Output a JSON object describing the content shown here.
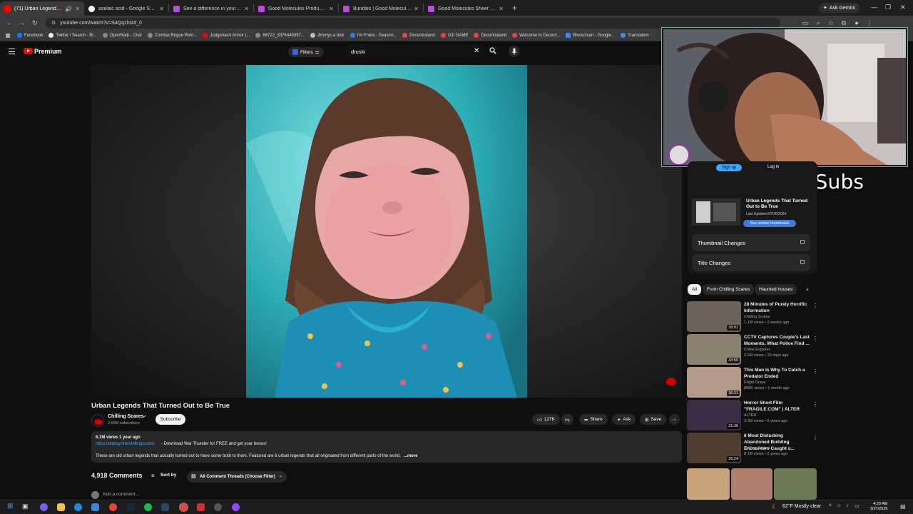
{
  "browser": {
    "tabs": [
      {
        "title": "(71) Urban Legends That Tu",
        "active": true,
        "favicon_color": "#ff0000"
      },
      {
        "title": "azelaic acid - Google Search",
        "active": false,
        "favicon_color": "#ffffff"
      },
      {
        "title": "See a difference in your skin | G",
        "active": false,
        "favicon_color": "#b44fd6"
      },
      {
        "title": "Good Molecules Products | Goo",
        "active": false,
        "favicon_color": "#b44fd6"
      },
      {
        "title": "Bundles | Good Molecules",
        "active": false,
        "favicon_color": "#b44fd6"
      },
      {
        "title": "Good Molecules Sheer Mineral",
        "active": false,
        "favicon_color": "#b44fd6"
      }
    ],
    "gemini_label": "Ask Gemini",
    "url": "youtube.com/watch?v=S4Qq1htzd_0",
    "bookmarks": [
      "Facebook",
      "Twitter / Search - Bi...",
      "OpenRadi - Chat",
      "Combat Rogue Refo...",
      "Judgement Armor (...",
      "66722_3376446997...",
      "Jimmys a dick",
      "I'm Frank - Season...",
      "Decentraland",
      "OJI GAME",
      "Decentraland",
      "Welcome to Decent...",
      "Blockchain - Google...",
      "Translation"
    ]
  },
  "youtube": {
    "brand": "Premium",
    "filters_label": "Filters",
    "search_value": "druski",
    "video": {
      "title": "Urban Legends That Turned Out to Be True",
      "channel": "Chilling Scares",
      "subscribers": "2.69M subscribers",
      "subscribe_label": "Subscribe",
      "likes": "127K",
      "share_label": "Share",
      "ask_label": "Ask",
      "save_label": "Save",
      "views_age": "6.1M views  1 year ago",
      "desc_link": "https://wtplay.link/chillingscares",
      "desc_promo": "- Download War Thunder for FREE and get your bonus!",
      "desc_body": "These are old urban legends that actually turned out to have some truth to them. Featured are 6 urban legends that all originated from different parts of the world.",
      "desc_more": "...more"
    },
    "comments": {
      "count_label": "4,918 Comments",
      "sort_label": "Sort by",
      "thread_filter": "All Comment Threads (Choose Filter)",
      "add_placeholder": "Add a comment..."
    },
    "extension_panel": {
      "sign_up": "Sign up",
      "log_in": "Log in",
      "card_title": "Urban Legends That Turned Out to Be True",
      "last_updated": "Last Updated 07/30/2024",
      "see_similar": "See similar thumbnails",
      "thumbnail_changes": "Thumbnail Changes",
      "title_changes": "Title Changes"
    },
    "chips": [
      "All",
      "From Chilling Scares",
      "Haunted houses"
    ],
    "recommendations": [
      {
        "title": "28 Minutes of Purely Horrific Information",
        "channel": "Chilling Scares",
        "meta": "1.1M views • 2 weeks ago",
        "duration": "28:01",
        "thumb_color": "#6a6259"
      },
      {
        "title": "CCTV Captures Couple's Last Moments, What Police Find ...",
        "channel": "Crime Explorer",
        "meta": "3.2M views • 10 days ago",
        "duration": "43:50",
        "thumb_color": "#8a8070"
      },
      {
        "title": "This Man Is Why To Catch a Predator Ended",
        "channel": "Fright Grave",
        "meta": "896K views • 1 month ago",
        "duration": "36:21",
        "thumb_color": "#b49a8a"
      },
      {
        "title": "Horror Short Film \"FRAGILE.COM\" | ALTER",
        "channel": "ALTER",
        "meta": "3.3M views • 5 years ago",
        "duration": "21:36",
        "thumb_color": "#3a2d44"
      },
      {
        "title": "6 Most Disturbing Abandoned Building Encounters Caught o...",
        "channel": "Chilling Scares",
        "meta": "8.1M views • 2 years ago",
        "duration": "26:24",
        "thumb_color": "#4c3d30"
      }
    ]
  },
  "overlay": {
    "sub_goal": "68/70 : Subs"
  },
  "taskbar": {
    "weather": "62°F  Mostly clear",
    "time": "4:20 AM",
    "date": "3/27/2025"
  }
}
